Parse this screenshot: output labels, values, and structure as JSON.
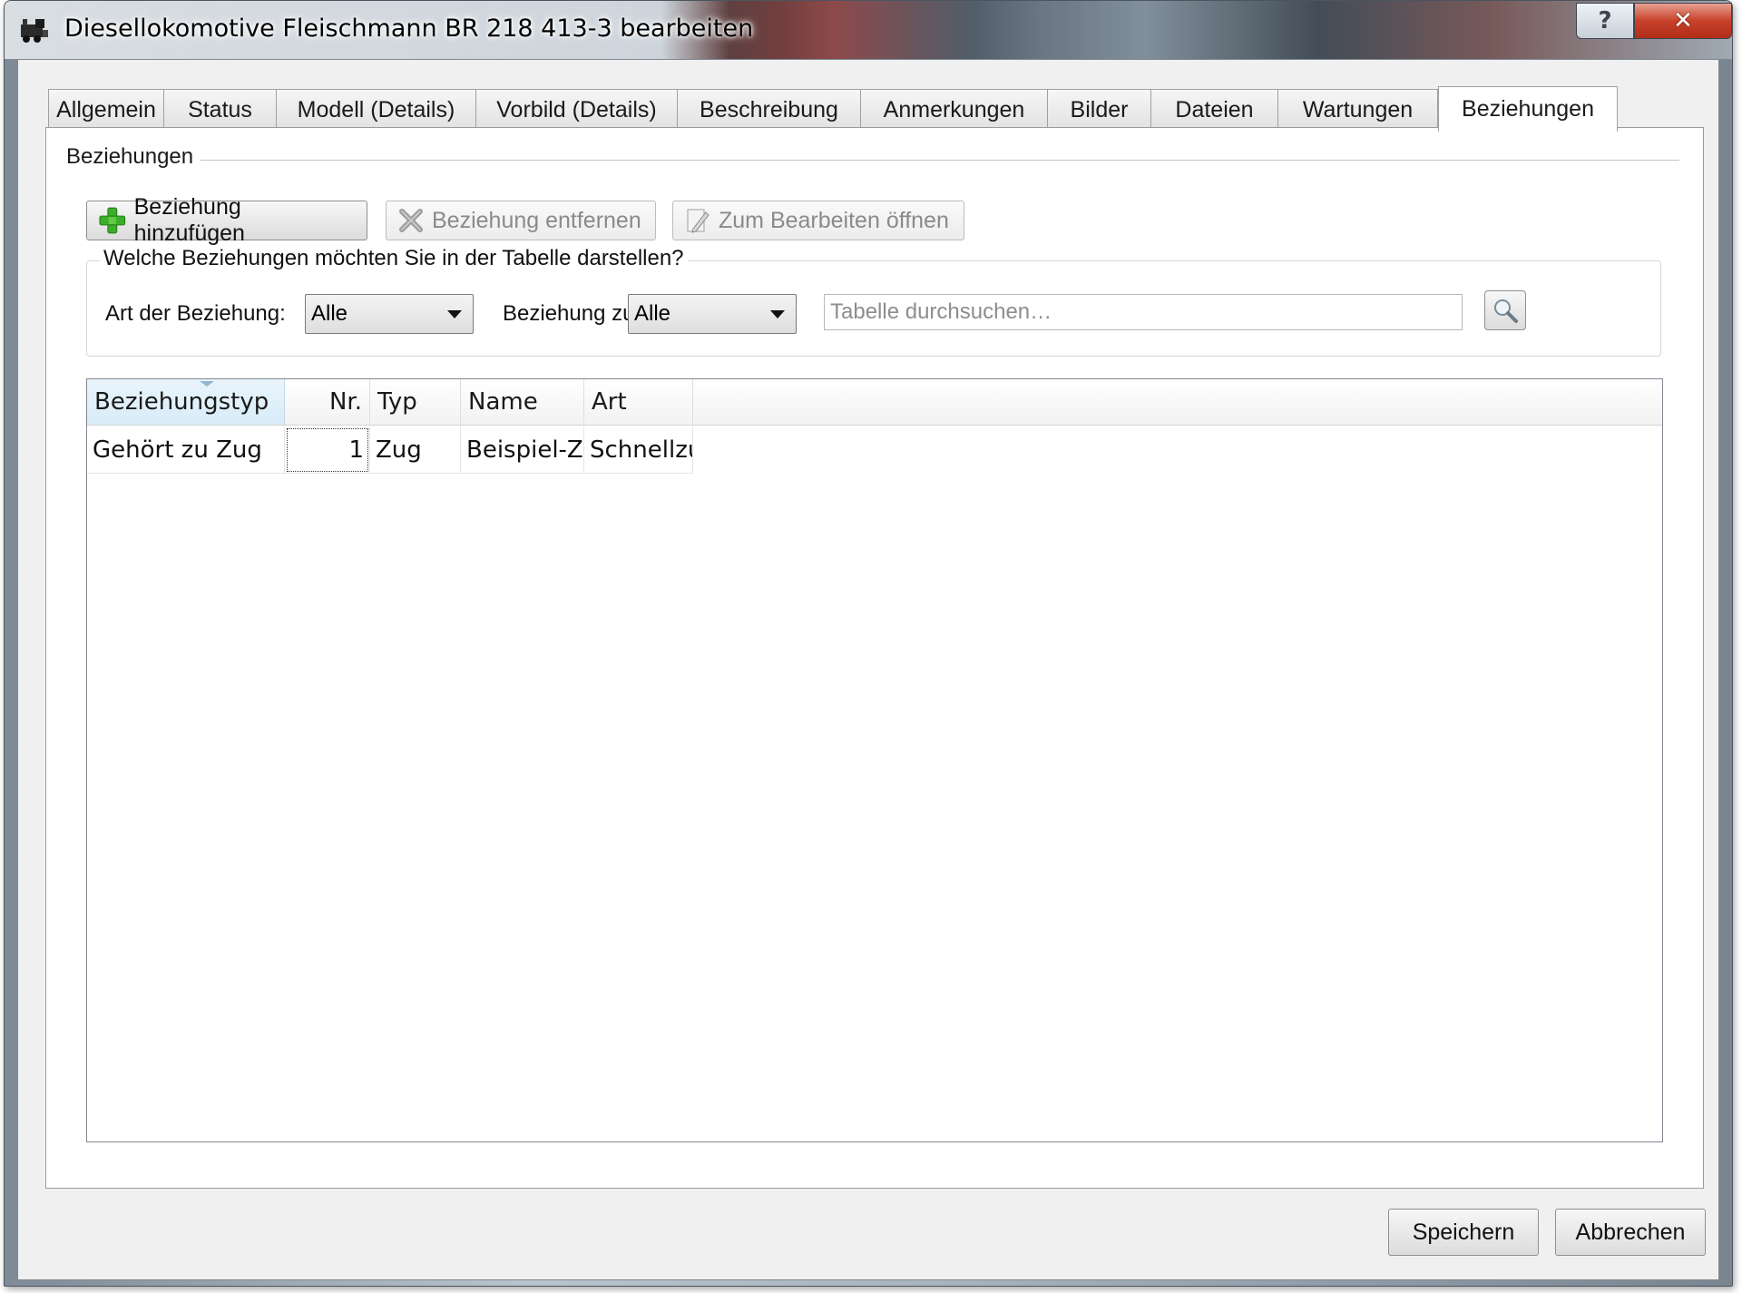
{
  "window": {
    "title": "Diesellokomotive Fleischmann BR 218 413-3 bearbeiten",
    "help_label": "?",
    "close_label": "✕"
  },
  "tabs": [
    {
      "label": "Allgemein",
      "active": false
    },
    {
      "label": "Status",
      "active": false
    },
    {
      "label": "Modell (Details)",
      "active": false
    },
    {
      "label": "Vorbild (Details)",
      "active": false
    },
    {
      "label": "Beschreibung",
      "active": false
    },
    {
      "label": "Anmerkungen",
      "active": false
    },
    {
      "label": "Bilder",
      "active": false
    },
    {
      "label": "Dateien",
      "active": false
    },
    {
      "label": "Wartungen",
      "active": false
    },
    {
      "label": "Beziehungen",
      "active": true
    }
  ],
  "section": {
    "title": "Beziehungen"
  },
  "toolbar": {
    "add_label": "Beziehung hinzufügen",
    "add_icon": "plus-icon",
    "remove_label": "Beziehung entfernen",
    "remove_icon": "remove-icon",
    "edit_label": "Zum Bearbeiten öffnen",
    "edit_icon": "edit-icon"
  },
  "filter": {
    "legend": "Welche Beziehungen möchten Sie in der Tabelle darstellen?",
    "type_label": "Art der Beziehung:",
    "type_value": "Alle",
    "target_label": "Beziehung zu:",
    "target_value": "Alle",
    "search_placeholder": "Tabelle durchsuchen…"
  },
  "table": {
    "columns": [
      "Beziehungstyp",
      "Nr.",
      "Typ",
      "Name",
      "Art"
    ],
    "sorted_column": "Beziehungstyp",
    "rows": [
      {
        "beziehungstyp": "Gehört zu Zug",
        "nr": "1",
        "typ": "Zug",
        "name": "Beispiel-Zug",
        "art": "Schnellzug"
      }
    ]
  },
  "footer": {
    "save_label": "Speichern",
    "cancel_label": "Abbrechen"
  },
  "colors": {
    "accent_plus": "#3cae2a",
    "remove_gray": "#8a8a8a",
    "close_red": "#c8412a",
    "sorted_header": "#d8ecf8"
  }
}
